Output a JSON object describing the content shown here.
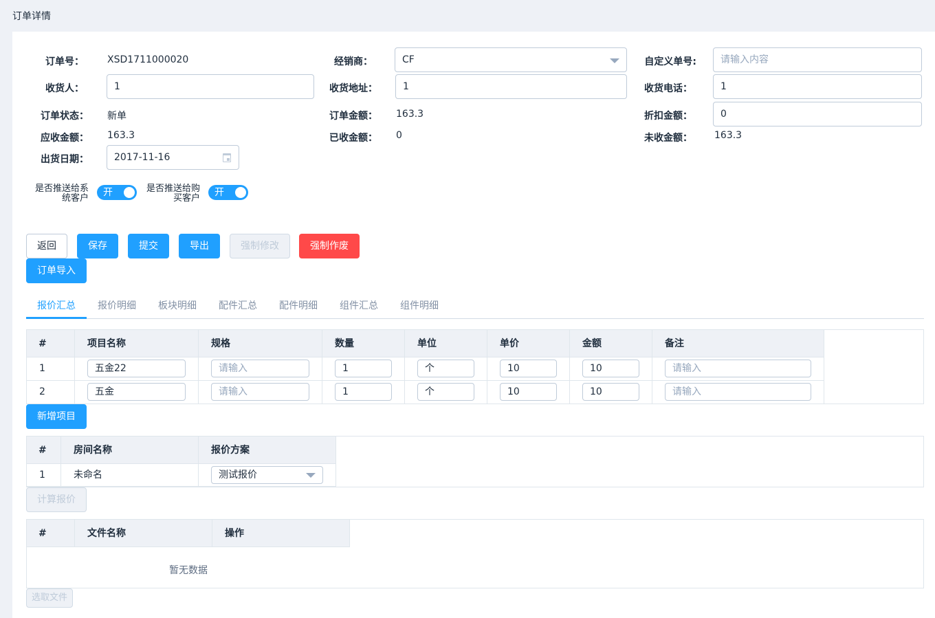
{
  "header": {
    "title": "订单详情"
  },
  "form": {
    "order_no_label": "订单号：",
    "order_no": "XSD1711000020",
    "dealer_label": "经销商：",
    "dealer_value": "CF",
    "custom_no_label": "自定义单号:",
    "custom_no_placeholder": "请输入内容",
    "receiver_label": "收货人：",
    "receiver_value": "1",
    "address_label": "收货地址：",
    "address_value": "1",
    "phone_label": "收货电话：",
    "phone_value": "1",
    "status_label": "订单状态：",
    "status_value": "新单",
    "amount_label": "订单金额：",
    "amount_value": "163.3",
    "discount_label": "折扣金额：",
    "discount_value": "0",
    "receivable_label": "应收金额：",
    "receivable_value": "163.3",
    "received_label": "已收金额：",
    "received_value": "0",
    "unreceived_label": "未收金额：",
    "unreceived_value": "163.3",
    "ship_date_label": "出货日期：",
    "ship_date_value": "2017-11-16",
    "push_system_label_1": "是否推送给系",
    "push_system_label_2": "统客户",
    "push_system_text": "开",
    "push_system_on": true,
    "push_buyer_label_1": "是否推送给购",
    "push_buyer_label_2": "买客户",
    "push_buyer_text": "开",
    "push_buyer_on": true
  },
  "actions": {
    "back": "返回",
    "save": "保存",
    "submit": "提交",
    "export": "导出",
    "force_edit": "强制修改",
    "force_void": "强制作废",
    "import_order": "订单导入"
  },
  "tabs": [
    "报价汇总",
    "报价明细",
    "板块明细",
    "配件汇总",
    "配件明细",
    "组件汇总",
    "组件明细"
  ],
  "items_table": {
    "headers": [
      "#",
      "项目名称",
      "规格",
      "数量",
      "单位",
      "单价",
      "金额",
      "备注"
    ],
    "input_placeholder": "请输入",
    "rows": [
      {
        "idx": "1",
        "name": "五金22",
        "spec": "",
        "qty": "1",
        "unit": "个",
        "price": "10",
        "amount": "10",
        "remark": ""
      },
      {
        "idx": "2",
        "name": "五金",
        "spec": "",
        "qty": "1",
        "unit": "个",
        "price": "10",
        "amount": "10",
        "remark": ""
      }
    ],
    "add_button": "新增项目"
  },
  "rooms_table": {
    "headers": [
      "#",
      "房间名称",
      "报价方案"
    ],
    "rows": [
      {
        "idx": "1",
        "room": "未命名",
        "scheme": "测试报价"
      }
    ],
    "calc_button": "计算报价"
  },
  "files_table": {
    "headers": [
      "#",
      "文件名称",
      "操作"
    ],
    "empty_text": "暂无数据",
    "select_button": "选取文件"
  },
  "colors": {
    "primary": "#20a0ff",
    "danger": "#ff4949",
    "border": "#bfcbd9",
    "header_bg": "#eef1f6"
  }
}
